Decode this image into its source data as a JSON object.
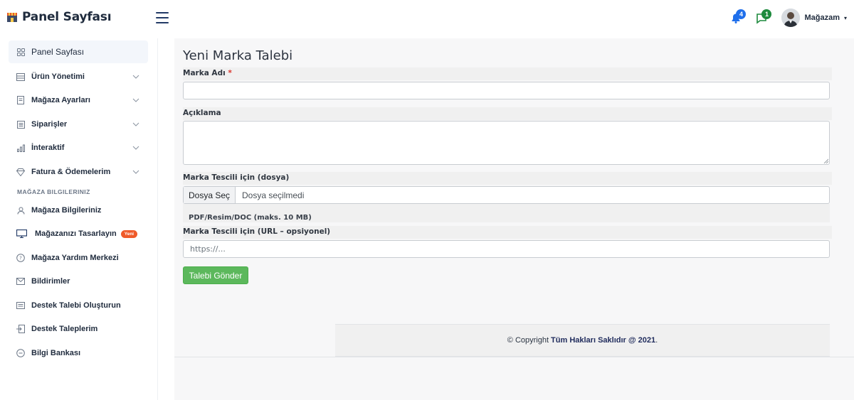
{
  "app": {
    "title": "Panel Sayfası"
  },
  "header": {
    "notifications_count": "4",
    "messages_count": "1",
    "user_name": "Mağazam",
    "user_caret": "▾"
  },
  "sidebar": {
    "items": [
      {
        "label": "Panel Sayfası",
        "icon": "grid-icon"
      },
      {
        "label": "Ürün Yönetimi",
        "icon": "table-icon",
        "has_submenu": true
      },
      {
        "label": "Mağaza Ayarları",
        "icon": "document-icon",
        "has_submenu": true
      },
      {
        "label": "Siparişler",
        "icon": "list-icon",
        "has_submenu": true
      },
      {
        "label": "İnteraktif",
        "icon": "bar-chart-icon",
        "has_submenu": true
      },
      {
        "label": "Fatura & Ödemelerim",
        "icon": "diamond-icon",
        "has_submenu": true
      }
    ],
    "section_title": "MAĞAZA BILGILERINIZ",
    "store_items": [
      {
        "label": "Mağaza Bilgileriniz",
        "icon": "user-icon"
      },
      {
        "label": "Mağazanızı Tasarlayın",
        "icon": "monitor-icon",
        "badge": "Yeni"
      },
      {
        "label": "Mağaza Yardım Merkezi",
        "icon": "help-icon"
      },
      {
        "label": "Bildirimler",
        "icon": "mail-icon"
      },
      {
        "label": "Destek Talebi Oluşturun",
        "icon": "ticket-icon"
      },
      {
        "label": "Destek Taleplerim",
        "icon": "signin-icon"
      },
      {
        "label": "Bilgi Bankası",
        "icon": "minus-circle-icon"
      }
    ]
  },
  "form": {
    "page_title": "Yeni Marka Talebi",
    "brand_name_label": "Marka Adı",
    "required_mark": "*",
    "brand_name_value": "",
    "description_label": "Açıklama",
    "description_value": "",
    "file_label": "Marka Tescili için (dosya)",
    "file_button": "Dosya Seç",
    "file_status": "Dosya seçilmedi",
    "file_hint": "PDF/Resim/DOC (maks. 10 MB)",
    "url_label": "Marka Tescili için (URL – opsiyonel)",
    "url_placeholder": "https://...",
    "submit_label": "Talebi Gönder"
  },
  "footer": {
    "copyright_prefix": "© Copyright",
    "copyright_bold": "Tüm Hakları Saklıdır @ 2021",
    "copyright_suffix": "."
  },
  "colors": {
    "accent_blue": "#1f6feb",
    "accent_green": "#1d8a3d",
    "submit_green": "#5cb85c",
    "badge_orange": "#ef5a29"
  }
}
